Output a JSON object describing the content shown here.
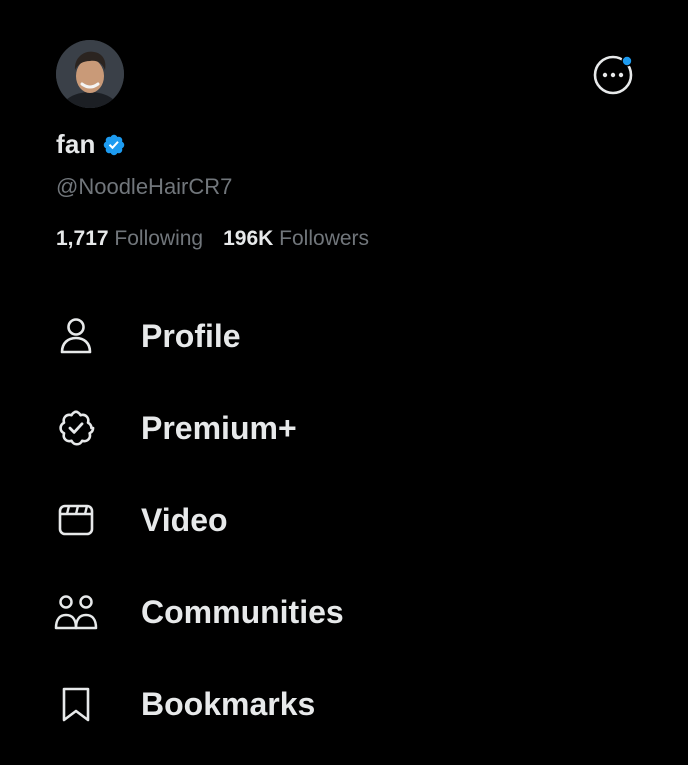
{
  "profile": {
    "display_name": "fan",
    "handle": "@NoodleHairCR7",
    "verified": true,
    "following_count": "1,717",
    "following_label": "Following",
    "followers_count": "196K",
    "followers_label": "Followers"
  },
  "header": {
    "more_icon": "more-circle-icon",
    "notification_dot": true
  },
  "menu": {
    "items": [
      {
        "label": "Profile",
        "icon": "person-icon"
      },
      {
        "label": "Premium+",
        "icon": "verified-badge-outline-icon"
      },
      {
        "label": "Video",
        "icon": "video-clapper-icon"
      },
      {
        "label": "Communities",
        "icon": "communities-icon"
      },
      {
        "label": "Bookmarks",
        "icon": "bookmark-icon"
      }
    ]
  },
  "colors": {
    "background": "#000000",
    "primary_text": "#e7e9ea",
    "secondary_text": "#71767b",
    "accent": "#1d9bf0"
  }
}
